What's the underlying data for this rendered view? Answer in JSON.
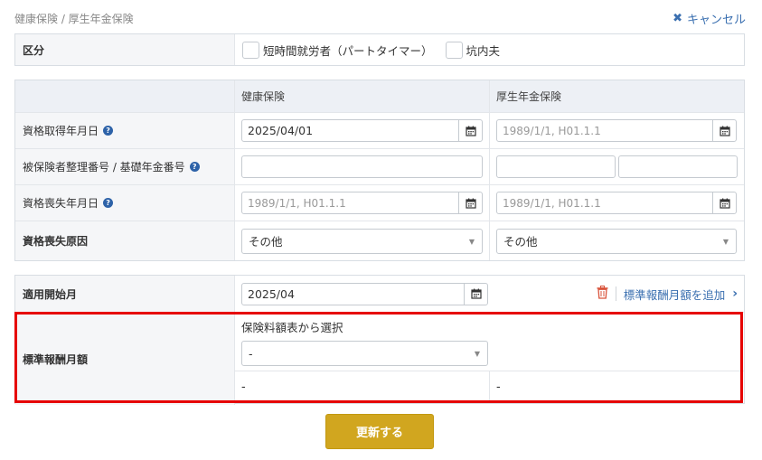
{
  "breadcrumb": "健康保険 / 厚生年金保険",
  "cancel_label": "キャンセル",
  "classification": {
    "label": "区分",
    "options": [
      "短時間就労者（パートタイマー）",
      "坑内夫"
    ]
  },
  "table": {
    "col_health": "健康保険",
    "col_pension": "厚生年金保険",
    "rows": {
      "acquire": {
        "label": "資格取得年月日",
        "health_value": "2025/04/01",
        "pension_placeholder": "1989/1/1, H01.1.1"
      },
      "insured_no": {
        "label": "被保険者整理番号 / 基礎年金番号"
      },
      "loss": {
        "label": "資格喪失年月日",
        "health_placeholder": "1989/1/1, H01.1.1",
        "pension_placeholder": "1989/1/1, H01.1.1"
      },
      "loss_reason": {
        "label": "資格喪失原因",
        "health_value": "その他",
        "pension_value": "その他"
      }
    }
  },
  "applied": {
    "label": "適用開始月",
    "value": "2025/04",
    "add_label": "標準報酬月額を追加"
  },
  "standard": {
    "label": "標準報酬月額",
    "select_title": "保険料額表から選択",
    "select_value": "-",
    "health_value": "-",
    "pension_value": "-"
  },
  "submit_label": "更新する",
  "colors": {
    "accent": "#d1a61f",
    "link": "#3a6fb0",
    "highlight": "#e60000"
  }
}
